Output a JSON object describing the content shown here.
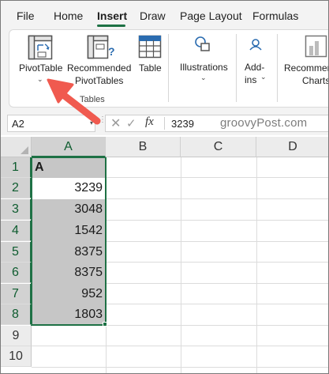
{
  "menu": {
    "tabs": [
      {
        "label": "File"
      },
      {
        "label": "Home"
      },
      {
        "label": "Insert"
      },
      {
        "label": "Draw"
      },
      {
        "label": "Page Layout"
      },
      {
        "label": "Formulas"
      }
    ],
    "active_tab": "Insert"
  },
  "ribbon": {
    "pivottable_label": "PivotTable",
    "recommended_line1": "Recommended",
    "recommended_line2": "PivotTables",
    "table_label": "Table",
    "group_label": "Tables",
    "illustrations_label": "Illustrations",
    "addins_line1": "Add-",
    "addins_line2": "ins",
    "charts_line1": "Recommen",
    "charts_line2": "Charts"
  },
  "formula_bar": {
    "name_box": "A2",
    "fx_symbol": "fx",
    "value": "3239"
  },
  "watermark": "groovyPost.com",
  "grid": {
    "columns": [
      "A",
      "B",
      "C",
      "D"
    ],
    "rows": [
      "1",
      "2",
      "3",
      "4",
      "5",
      "6",
      "7",
      "8",
      "9",
      "10"
    ],
    "cells_A": [
      "A",
      "3239",
      "3048",
      "1542",
      "8375",
      "8375",
      "952",
      "1803"
    ]
  },
  "colors": {
    "accent": "#1e7145",
    "selection": "#c6c6c6",
    "arrow": "#f05a4f"
  },
  "annotation": {
    "shape": "arrow",
    "points_to": "pivottable-button"
  }
}
